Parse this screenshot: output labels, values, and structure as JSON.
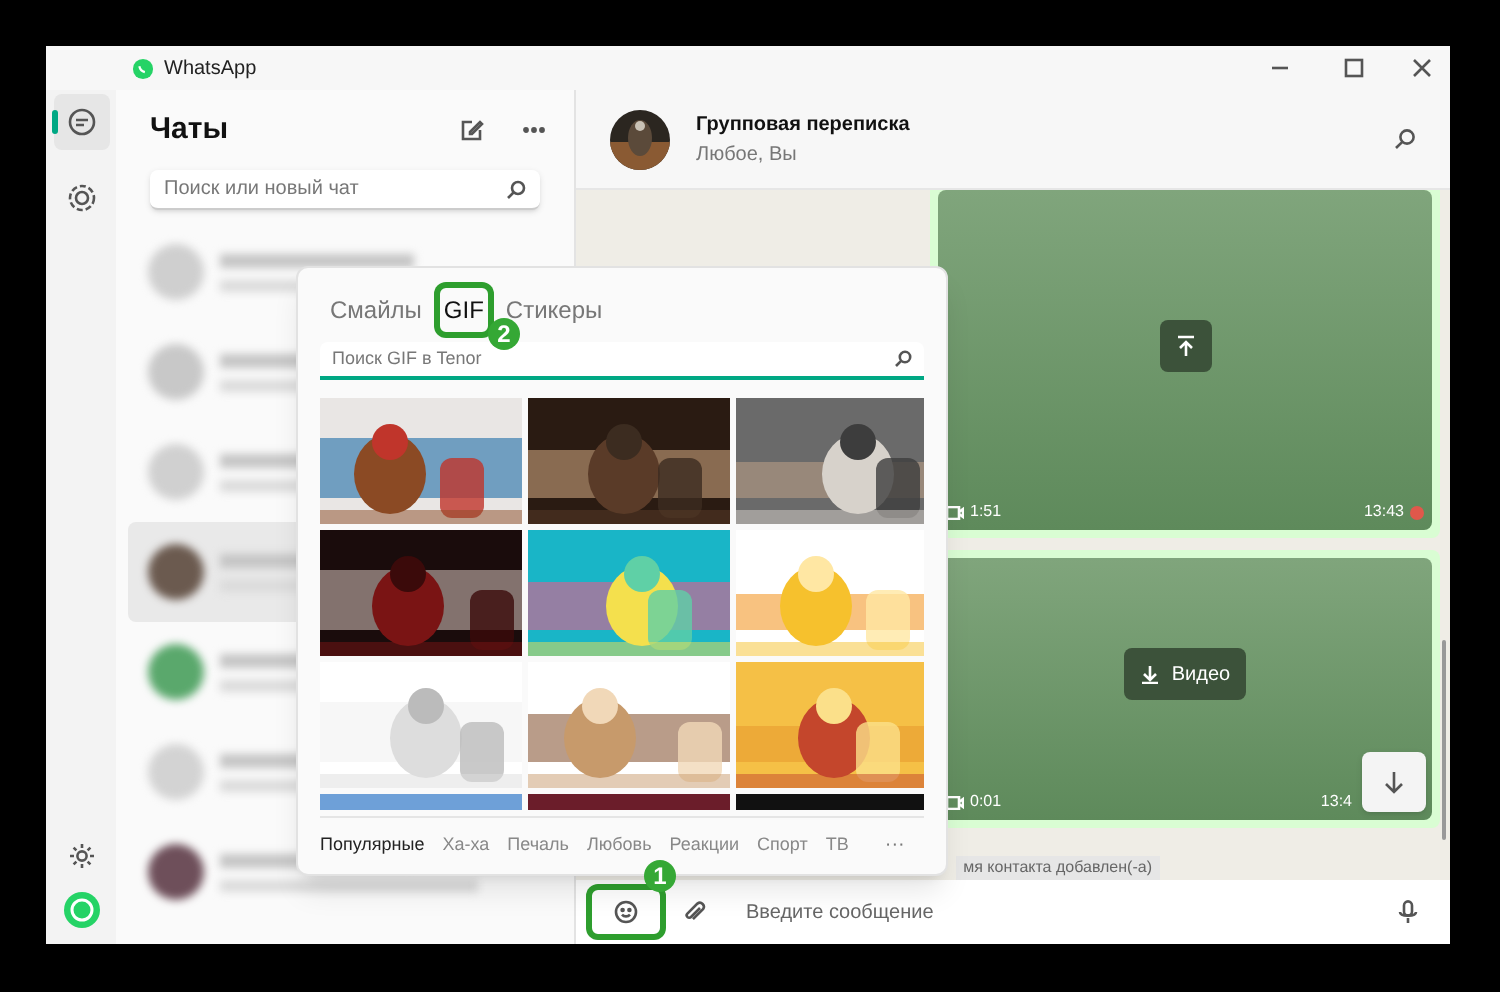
{
  "window": {
    "title": "WhatsApp"
  },
  "rail": {
    "items": [
      {
        "kind": "chats",
        "selected": true
      },
      {
        "kind": "status",
        "selected": false
      }
    ],
    "bottom": [
      {
        "kind": "settings"
      },
      {
        "kind": "profile"
      }
    ]
  },
  "chat_list": {
    "title": "Чаты",
    "search": {
      "placeholder": "Поиск или новый чат"
    },
    "rows": [
      {
        "selected": false
      },
      {
        "selected": false
      },
      {
        "selected": false
      },
      {
        "selected": true
      },
      {
        "selected": false
      },
      {
        "selected": false
      },
      {
        "selected": false
      }
    ]
  },
  "chat": {
    "title": "Групповая переписка",
    "subtitle": "Любое, Вы",
    "messages": [
      {
        "kind": "upload",
        "duration": "1:51",
        "time": "13:43"
      },
      {
        "kind": "download",
        "label": "Видео",
        "duration": "0:01",
        "time": "13:4"
      }
    ],
    "system_note": "мя контакта добавлен(-а)",
    "composer": {
      "placeholder": "Введите сообщение"
    }
  },
  "gif_panel": {
    "tabs": [
      {
        "label": "Смайлы",
        "selected": false
      },
      {
        "label": "GIF",
        "selected": true
      },
      {
        "label": "Стикеры",
        "selected": false
      }
    ],
    "search": {
      "placeholder": "Поиск GIF в Tenor"
    },
    "categories": [
      {
        "label": "Популярные",
        "selected": true
      },
      {
        "label": "Ха-ха",
        "selected": false
      },
      {
        "label": "Печаль",
        "selected": false
      },
      {
        "label": "Любовь",
        "selected": false
      },
      {
        "label": "Реакции",
        "selected": false
      },
      {
        "label": "Спорт",
        "selected": false
      },
      {
        "label": "ТВ",
        "selected": false
      }
    ],
    "more": "···"
  },
  "annotations": [
    {
      "kind": "emoji",
      "label": "1"
    },
    {
      "kind": "gif_tab",
      "label": "2"
    }
  ]
}
